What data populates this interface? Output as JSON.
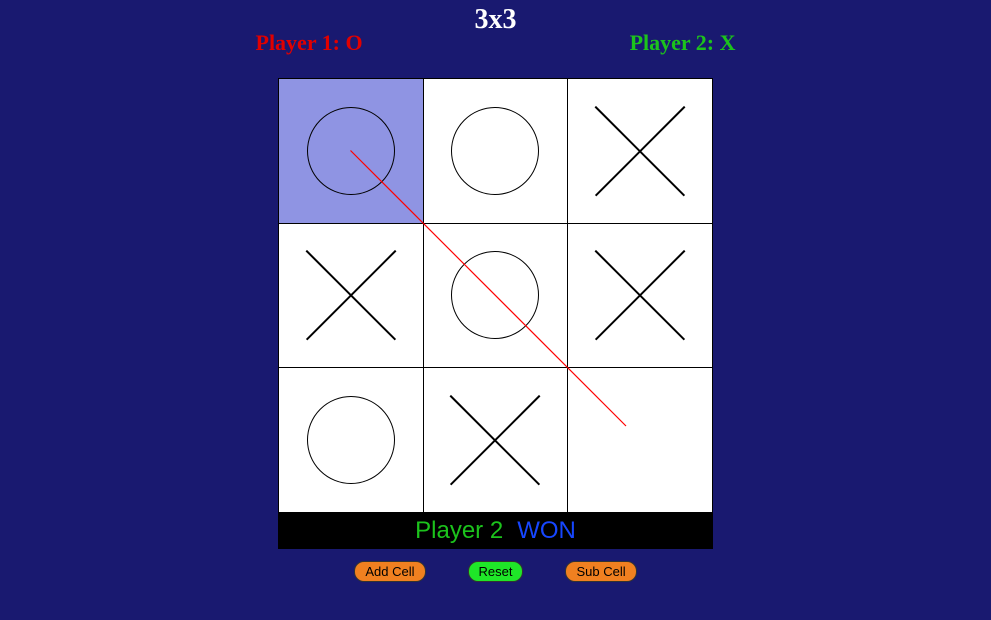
{
  "header": {
    "grid_size_label": "3x3",
    "player1_label": "Player 1: O",
    "player2_label": "Player 2: X"
  },
  "board": {
    "size": 3,
    "cells": [
      {
        "mark": "O",
        "highlight": true
      },
      {
        "mark": "O",
        "highlight": false
      },
      {
        "mark": "X",
        "highlight": false
      },
      {
        "mark": "X",
        "highlight": false
      },
      {
        "mark": "O",
        "highlight": false
      },
      {
        "mark": "X",
        "highlight": false
      },
      {
        "mark": "O",
        "highlight": false
      },
      {
        "mark": "X",
        "highlight": false
      },
      {
        "mark": "",
        "highlight": false
      }
    ],
    "win_line": {
      "from": [
        0,
        0
      ],
      "to": [
        2,
        2
      ],
      "color": "#ff0000"
    }
  },
  "status": {
    "player_text": "Player 2",
    "result_text": "WON"
  },
  "controls": {
    "add_label": "Add Cell",
    "reset_label": "Reset",
    "sub_label": "Sub Cell"
  }
}
